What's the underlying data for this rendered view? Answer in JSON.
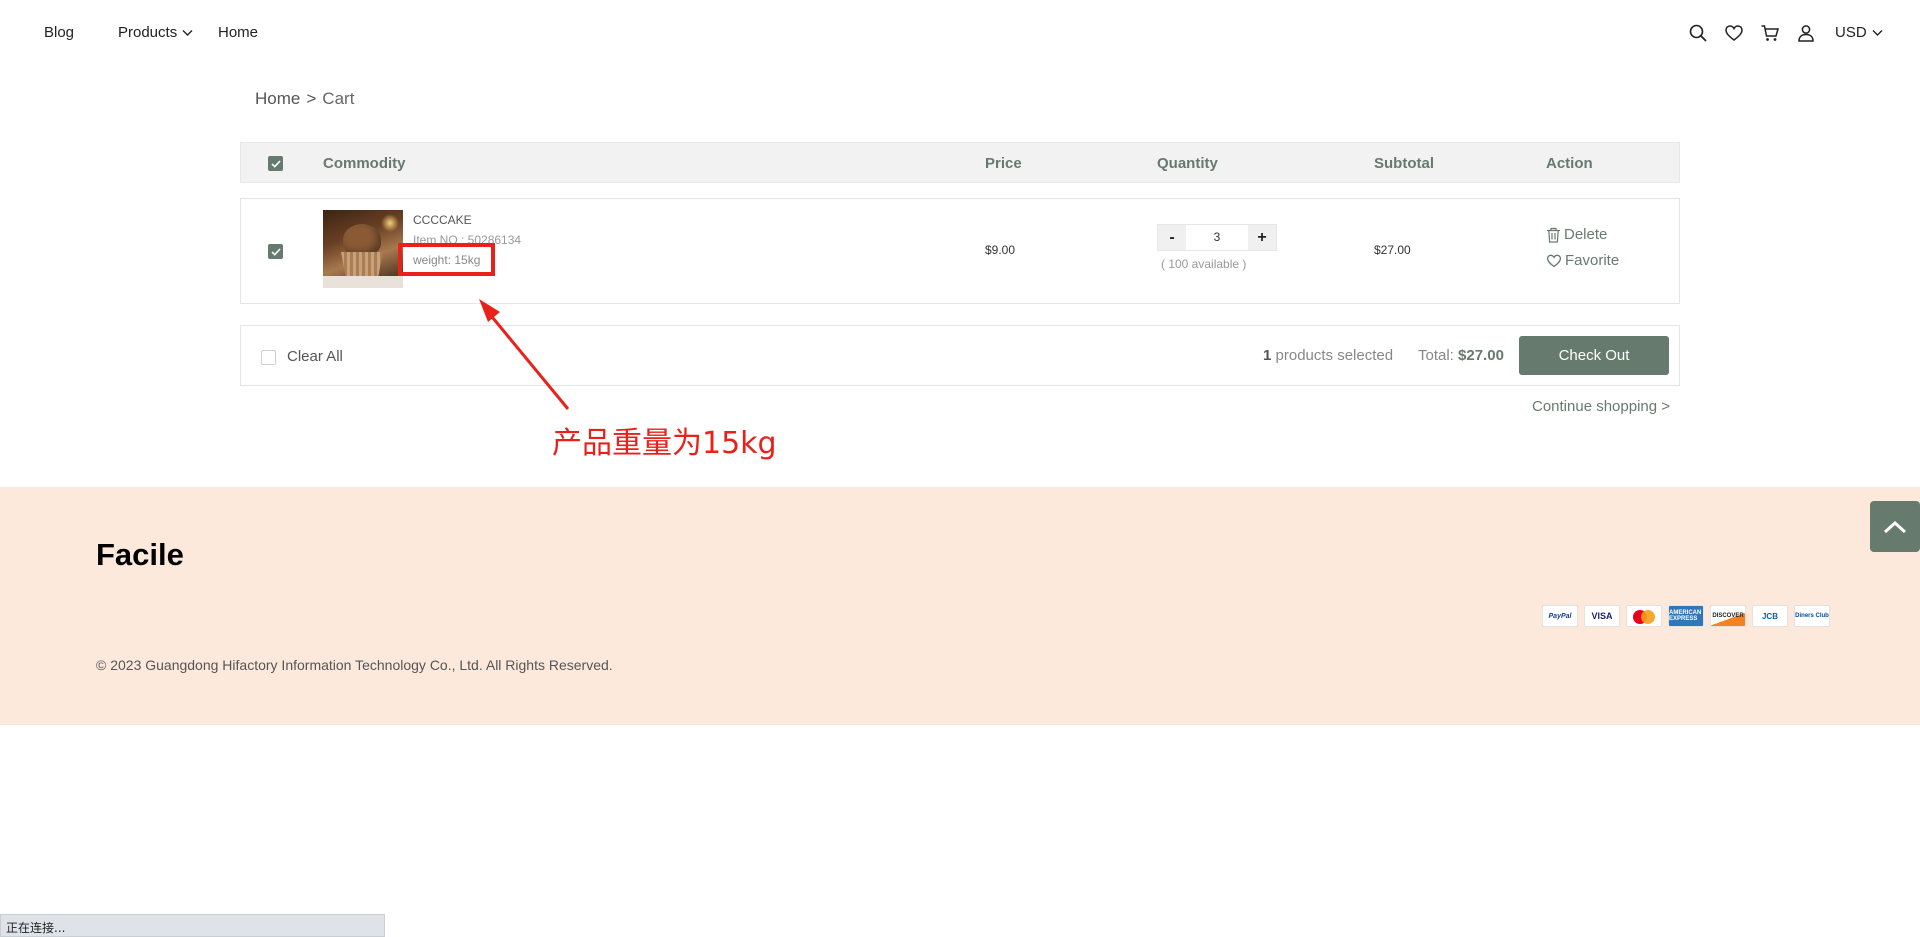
{
  "header": {
    "nav": {
      "blog": "Blog",
      "products": "Products",
      "home": "Home"
    },
    "currency": "USD",
    "icons": [
      "search-icon",
      "heart-icon",
      "cart-icon",
      "user-icon",
      "chevron-down-icon"
    ]
  },
  "breadcrumb": {
    "home": "Home",
    "separator": ">",
    "current": "Cart"
  },
  "table": {
    "headers": {
      "commodity": "Commodity",
      "price": "Price",
      "quantity": "Quantity",
      "subtotal": "Subtotal",
      "action": "Action"
    },
    "select_all_checked": true
  },
  "cart_items": [
    {
      "checked": true,
      "name": "CCCCAKE",
      "item_no": "Item NO.: 50286134",
      "weight": "weight: 15kg",
      "price": "$9.00",
      "quantity": "3",
      "available": "( 100 available )",
      "subtotal": "$27.00",
      "actions": {
        "delete": "Delete",
        "favorite": "Favorite"
      },
      "qty_minus": "-",
      "qty_plus": "+"
    }
  ],
  "summary": {
    "clear_all": "Clear All",
    "selected_count": "1",
    "selected_label": "products selected",
    "total_label": "Total:",
    "total_value": "$27.00",
    "checkout": "Check Out",
    "continue": "Continue shopping  >"
  },
  "annotation": {
    "text": "产品重量为15kg",
    "color": "#e8221b"
  },
  "footer": {
    "logo": "Facile",
    "copyright": "© 2023 Guangdong Hifactory Information Technology Co., Ltd. All Rights Reserved.",
    "payment_methods": {
      "paypal": "PayPal",
      "visa": "VISA",
      "mastercard": "",
      "amex": "AMERICAN EXPRESS",
      "discover": "DISCOVER",
      "jcb": "JCB",
      "diners": "Diners Club"
    },
    "background": "#fde9dc"
  },
  "status_bar": {
    "text": "正在连接..."
  },
  "colors": {
    "accent": "#667a6e",
    "annotation": "#e8221b"
  }
}
